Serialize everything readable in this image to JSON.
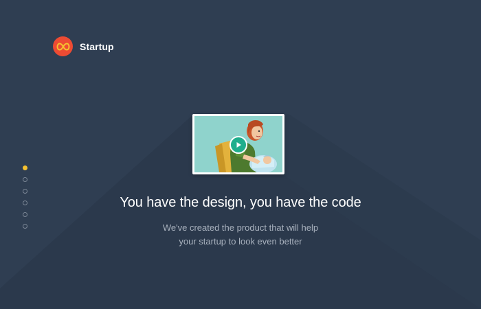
{
  "brand": {
    "name": "Startup",
    "logo_icon": "infinity-icon",
    "logo_color": "#ed4b33"
  },
  "pagination": {
    "count": 6,
    "active_index": 0,
    "active_color": "#f5c130"
  },
  "video": {
    "play_icon": "play-icon",
    "play_color": "#1fae8c"
  },
  "hero": {
    "headline": "You have the design, you have the code",
    "subtext_line1": "We've created the product that will help",
    "subtext_line2": "your startup to look even better"
  },
  "colors": {
    "background": "#2f3e52",
    "headline": "#ffffff",
    "subtext": "#a8b1bd"
  }
}
